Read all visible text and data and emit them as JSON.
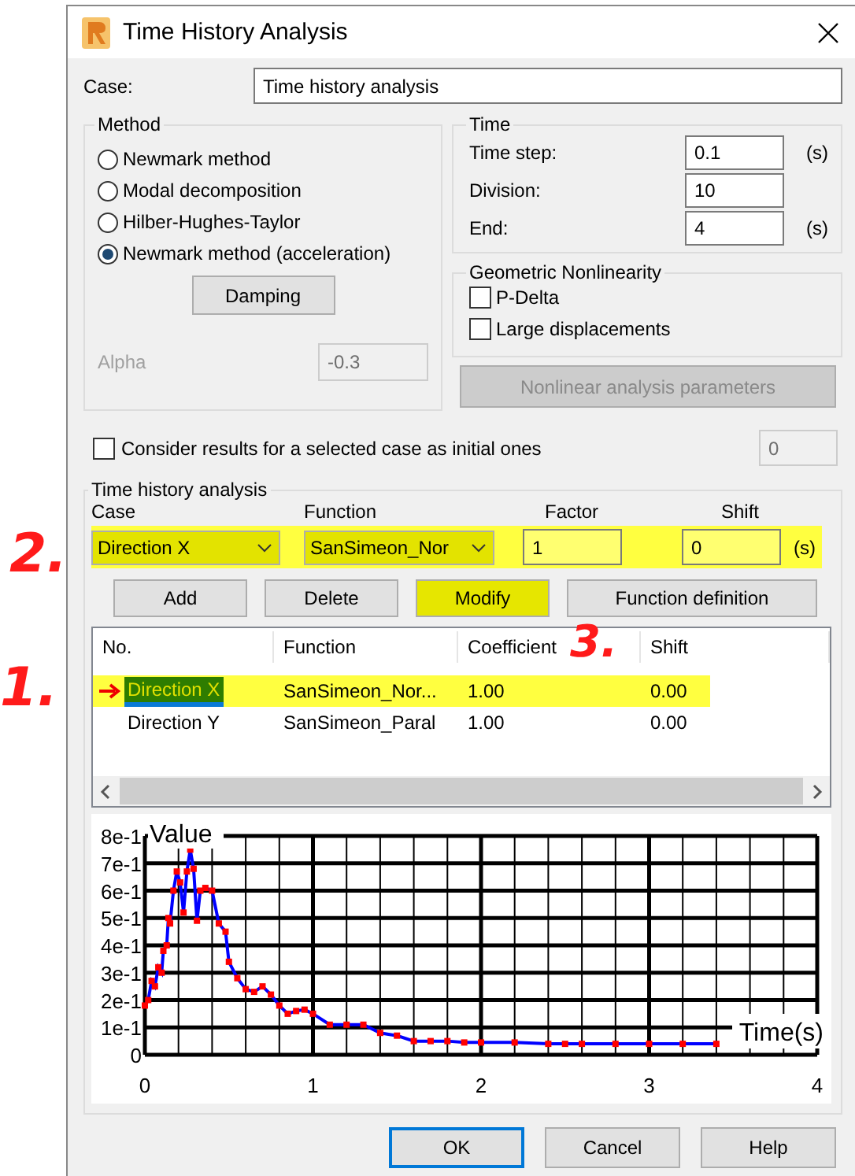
{
  "window": {
    "title": "Time History Analysis"
  },
  "case": {
    "label": "Case:",
    "value": "Time history analysis"
  },
  "method": {
    "title": "Method",
    "options": [
      {
        "label": "Newmark method",
        "selected": false
      },
      {
        "label": "Modal decomposition",
        "selected": false
      },
      {
        "label": "Hilber-Hughes-Taylor",
        "selected": false
      },
      {
        "label": "Newmark method (acceleration)",
        "selected": true
      }
    ],
    "damping_button": "Damping",
    "alpha": {
      "label": "Alpha",
      "value": "-0.3",
      "disabled": true
    }
  },
  "time": {
    "title": "Time",
    "fields": [
      {
        "label": "Time step:",
        "value": "0.1",
        "unit": "(s)"
      },
      {
        "label": "Division:",
        "value": "10"
      },
      {
        "label": "End:",
        "value": "4",
        "unit": "(s)"
      }
    ]
  },
  "geometric_nonlinearity": {
    "title": "Geometric Nonlinearity",
    "options": [
      {
        "label": "P-Delta",
        "checked": false
      },
      {
        "label": "Large displacements",
        "checked": false
      }
    ]
  },
  "nonlinear_button": {
    "label": "Nonlinear analysis parameters",
    "disabled": true
  },
  "initial_case": {
    "label": "Consider results for a selected case as initial ones",
    "checked": false,
    "value": "0",
    "disabled": true
  },
  "time_history": {
    "title": "Time history analysis",
    "inputs": {
      "highlighted": true,
      "case_label": "Case",
      "case_value": "Direction X",
      "function_label": "Function",
      "function_value": "SanSimeon_Nor",
      "factor_label": "Factor",
      "factor_value": "1",
      "shift_label": "Shift",
      "shift_value": "0",
      "unit": "(s)"
    },
    "buttons": [
      {
        "label": "Add",
        "highlighted": false
      },
      {
        "label": "Delete",
        "highlighted": false
      },
      {
        "label": "Modify",
        "highlighted": true
      },
      {
        "label": "Function definition",
        "highlighted": false
      }
    ],
    "table": {
      "columns": [
        "No.",
        "Function",
        "Coefficient",
        "Shift"
      ],
      "rows": [
        {
          "no": "Direction X",
          "function": "SanSimeon_Nor...",
          "coefficient": "1.00",
          "shift": "0.00",
          "selected": true,
          "highlighted": true
        },
        {
          "no": "Direction Y",
          "function": "SanSimeon_Paral",
          "coefficient": "1.00",
          "shift": "0.00",
          "selected": false,
          "highlighted": false
        }
      ]
    },
    "chart_data": {
      "type": "line",
      "xlabel": "Time(s)",
      "ylabel": "Value",
      "x": [
        0,
        0.02,
        0.04,
        0.06,
        0.08,
        0.1,
        0.11,
        0.13,
        0.14,
        0.15,
        0.17,
        0.19,
        0.21,
        0.23,
        0.25,
        0.27,
        0.29,
        0.31,
        0.33,
        0.36,
        0.4,
        0.44,
        0.48,
        0.5,
        0.55,
        0.6,
        0.65,
        0.7,
        0.75,
        0.8,
        0.85,
        0.9,
        0.95,
        1.0,
        1.1,
        1.2,
        1.3,
        1.4,
        1.5,
        1.6,
        1.7,
        1.8,
        1.9,
        2.0,
        2.2,
        2.4,
        2.5,
        2.6,
        2.8,
        3.0,
        3.2,
        3.4
      ],
      "grid": true,
      "series": [
        {
          "color": "#0000ff",
          "marker": "square",
          "values": [
            0.18,
            0.2,
            0.27,
            0.25,
            0.32,
            0.3,
            0.38,
            0.4,
            0.5,
            0.48,
            0.6,
            0.67,
            0.63,
            0.52,
            0.67,
            0.75,
            0.68,
            0.49,
            0.6,
            0.61,
            0.6,
            0.48,
            0.45,
            0.34,
            0.28,
            0.24,
            0.23,
            0.25,
            0.22,
            0.18,
            0.15,
            0.16,
            0.165,
            0.15,
            0.11,
            0.11,
            0.11,
            0.08,
            0.07,
            0.05,
            0.05,
            0.05,
            0.045,
            0.045,
            0.045,
            0.04,
            0.04,
            0.04,
            0.04,
            0.04,
            0.04,
            0.04
          ]
        }
      ],
      "xlim": [
        0,
        4
      ],
      "ylim": [
        0,
        0.8
      ],
      "xticks": [
        0,
        1,
        2,
        3,
        4
      ],
      "yticks": [
        {
          "value": 0,
          "label": "0"
        },
        {
          "value": 0.1,
          "label": "1e-1"
        },
        {
          "value": 0.2,
          "label": "2e-1"
        },
        {
          "value": 0.3,
          "label": "3e-1"
        },
        {
          "value": 0.4,
          "label": "4e-1"
        },
        {
          "value": 0.5,
          "label": "5e-1"
        },
        {
          "value": 0.6,
          "label": "6e-1"
        },
        {
          "value": 0.7,
          "label": "7e-1"
        },
        {
          "value": 0.8,
          "label": "8e-1"
        }
      ]
    }
  },
  "annotations": [
    {
      "text": "2."
    },
    {
      "text": "3."
    },
    {
      "text": "1."
    }
  ],
  "footer_buttons": [
    {
      "label": "OK",
      "default": true
    },
    {
      "label": "Cancel",
      "default": false
    },
    {
      "label": "Help",
      "default": false
    }
  ]
}
